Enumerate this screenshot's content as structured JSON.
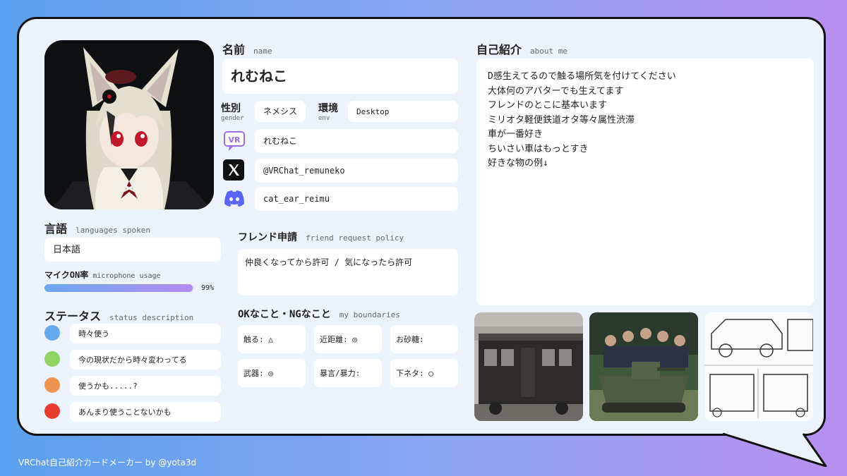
{
  "left": {
    "languages": {
      "title": "言語",
      "title_en": "languages spoken",
      "value": "日本語"
    },
    "mic": {
      "title": "マイクON率",
      "title_en": "microphone usage",
      "percent_label": "99%",
      "percent": 99
    },
    "status": {
      "title": "ステータス",
      "title_en": "status description",
      "items": [
        {
          "color": "#64aaea",
          "label": "時々使う"
        },
        {
          "color": "#8fd462",
          "label": "今の現状だから時々変わってる"
        },
        {
          "color": "#ef9552",
          "label": "使うかも.....?"
        },
        {
          "color": "#e73c2e",
          "label": "あんまり使うことないかも"
        }
      ]
    }
  },
  "middle": {
    "name": {
      "title": "名前",
      "title_en": "name",
      "value": "れむねこ"
    },
    "gender": {
      "title": "性別",
      "title_en": "gender",
      "value": "ネメシス"
    },
    "env": {
      "title": "環境",
      "title_en": "env",
      "value": "Desktop"
    },
    "vrchat": {
      "icon": "vrchat-icon",
      "value": "れむねこ"
    },
    "x": {
      "icon": "x-logo-icon",
      "value": "@VRChat_remuneko"
    },
    "discord": {
      "icon": "discord-icon",
      "value": "cat_ear_reimu"
    },
    "friend": {
      "title": "フレンド申請",
      "title_en": "friend request policy",
      "value": "仲良くなってから許可 / 気になったら許可"
    },
    "boundaries": {
      "title": "OKなこと・NGなこと",
      "title_en": "my boundaries",
      "items": [
        "触る: △",
        "近距離: ◎",
        "お砂糖:",
        "武器: ◎",
        "暴言/暴力:",
        "下ネタ: ◯"
      ]
    }
  },
  "right": {
    "about": {
      "title": "自己紹介",
      "title_en": "about me",
      "lines": [
        "D感生えてるので触る場所気を付けてください",
        "大体何のアバターでも生えてます",
        "フレンドのとこに基本います",
        "ミリオタ軽便鉄道オタ等々属性渋滞",
        "車が一番好き",
        "ちいさい車はもっとすき",
        "好きな物の例↓"
      ]
    }
  },
  "footer": {
    "text": "VRChat自己紹介カードメーカー by @yota3d"
  },
  "colors": {
    "accent_gradient_start": "#6aa8f0",
    "accent_gradient_end": "#b48cf2",
    "vrchat": "#9a6fe8",
    "discord": "#5865f2"
  }
}
